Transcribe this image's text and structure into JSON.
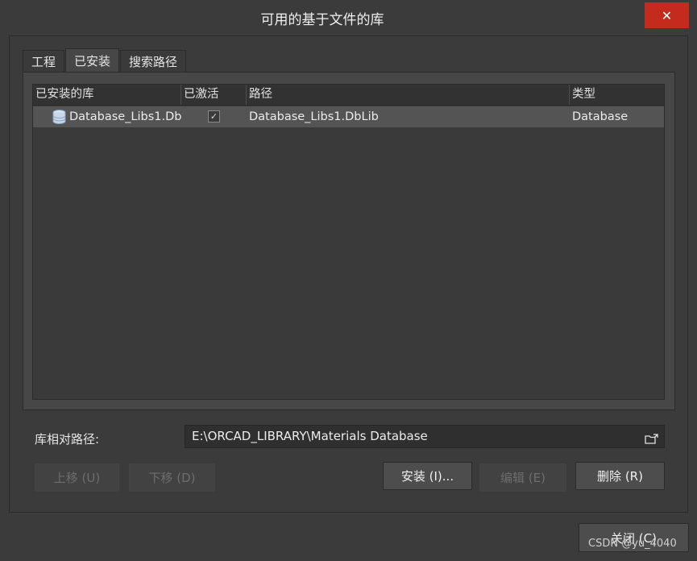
{
  "window": {
    "title": "可用的基于文件的库",
    "close_icon": "close-icon"
  },
  "tabs": [
    {
      "label": "工程"
    },
    {
      "label": "已安装"
    },
    {
      "label": "搜索路径"
    }
  ],
  "table": {
    "columns": [
      "已安装的库",
      "已激活",
      "路径",
      "类型"
    ],
    "rows": [
      {
        "icon": "database-icon",
        "name": "Database_Libs1.Db",
        "active": "✓",
        "path": "Database_Libs1.DbLib",
        "type": "Database"
      }
    ]
  },
  "relative_path": {
    "label": "库相对路径:",
    "value": "E:\\ORCAD_LIBRARY\\Materials Database",
    "browse_icon": "folder-open-icon"
  },
  "buttons": {
    "move_up": "上移 (U)",
    "move_down": "下移 (D)",
    "install": "安装 (I)...",
    "edit": "编辑 (E)",
    "delete": "删除 (R)",
    "close": "关闭 (C)"
  },
  "watermark": "CSDN @yu_4040",
  "colors": {
    "close_button": "#c42b1c",
    "selected_row": "#545454",
    "background": "#3b3b3b"
  }
}
